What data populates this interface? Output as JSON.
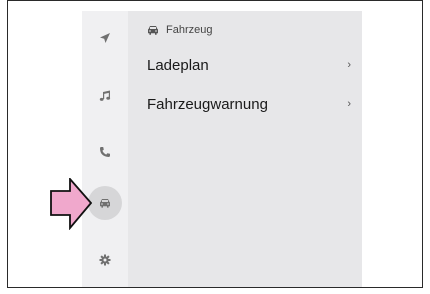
{
  "sidebar": {
    "items": [
      {
        "icon": "navigation-arrow-icon",
        "active": false
      },
      {
        "icon": "music-note-icon",
        "active": false
      },
      {
        "icon": "phone-icon",
        "active": false
      },
      {
        "icon": "car-icon",
        "active": true
      },
      {
        "icon": "gear-icon",
        "active": false
      }
    ]
  },
  "panel": {
    "title": "Fahrzeug",
    "title_icon": "car-icon",
    "items": [
      {
        "label": "Ladeplan",
        "chevron": "›"
      },
      {
        "label": "Fahrzeugwarnung",
        "chevron": "›"
      }
    ]
  },
  "annotation": {
    "icon": "pointer-arrow-icon",
    "color": "#f0a8cc"
  },
  "colors": {
    "sidebar_bg": "#f0f0f2",
    "panel_bg": "#e7e7e9",
    "active_item_bg": "#d6d6d8",
    "icon_color": "#707070"
  }
}
